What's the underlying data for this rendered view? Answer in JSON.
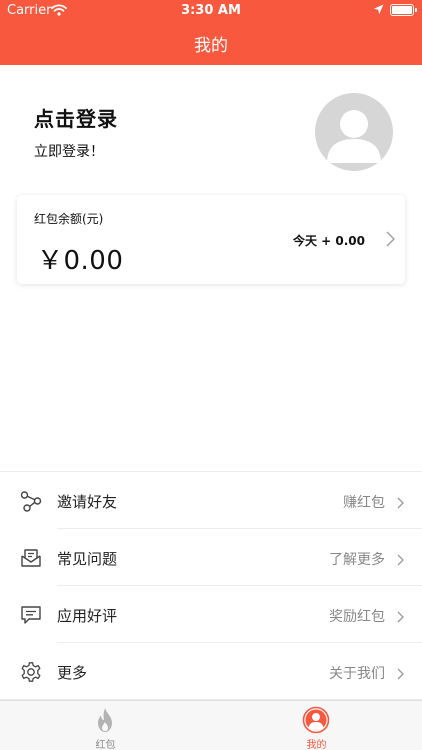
{
  "status_bar": {
    "carrier": "Carrier",
    "time": "3:30 AM"
  },
  "nav": {
    "title": "我的"
  },
  "login": {
    "title": "点击登录",
    "subtitle": "立即登录！"
  },
  "balance": {
    "label": "红包余额(元)",
    "amount": "￥0.00",
    "today": "今天 + 0.00"
  },
  "menu": [
    {
      "label": "邀请好友",
      "action": "赚红包",
      "icon": "share-icon"
    },
    {
      "label": "常见问题",
      "action": "了解更多",
      "icon": "mail-icon"
    },
    {
      "label": "应用好评",
      "action": "奖励红包",
      "icon": "comment-icon"
    },
    {
      "label": "更多",
      "action": "关于我们",
      "icon": "gear-icon"
    }
  ],
  "tabs": [
    {
      "label": "红包",
      "icon": "flame-icon",
      "active": false
    },
    {
      "label": "我的",
      "icon": "user-icon",
      "active": true
    }
  ],
  "colors": {
    "accent": "#f8583e",
    "inactive_tab": "#999999",
    "divider": "#ececec"
  }
}
